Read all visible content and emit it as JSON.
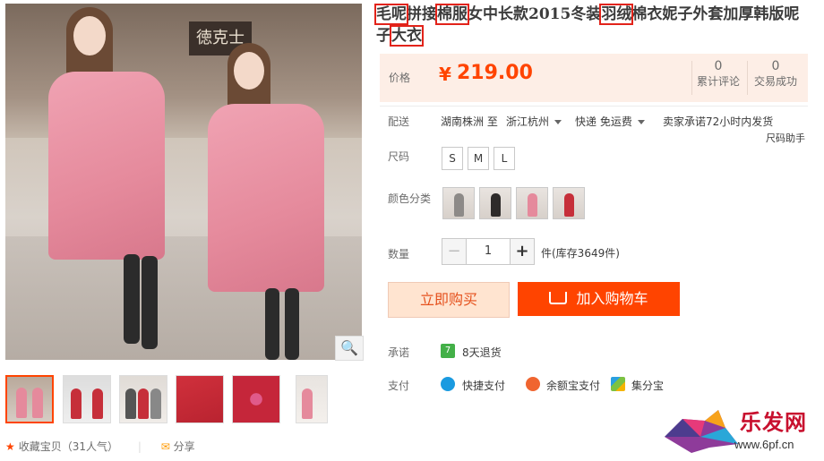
{
  "product": {
    "title_parts": [
      {
        "text": "毛呢",
        "highlight": true
      },
      {
        "text": "拼接",
        "highlight": false
      },
      {
        "text": "棉服",
        "highlight": true
      },
      {
        "text": "女中长款2015冬装",
        "highlight": false
      },
      {
        "text": "羽绒",
        "highlight": true
      },
      {
        "text": "棉衣妮子外套加厚韩版呢子",
        "highlight": false
      },
      {
        "text": "大衣",
        "highlight": true
      }
    ]
  },
  "price": {
    "label": "价格",
    "symbol": "¥",
    "value": "219.00"
  },
  "stats": [
    {
      "count": "0",
      "label": "累计评论"
    },
    {
      "count": "0",
      "label": "交易成功"
    }
  ],
  "shipping": {
    "label": "配送",
    "from": "湖南株洲 至",
    "to": "浙江杭州",
    "method": "快递 免运费",
    "promise": "卖家承诺72小时内发货",
    "size_help": "尺码助手"
  },
  "size": {
    "label": "尺码",
    "options": [
      "S",
      "M",
      "L"
    ]
  },
  "color": {
    "label": "颜色分类",
    "swatches": [
      "grey-coat",
      "black-coat",
      "pink-coat",
      "red-coat"
    ]
  },
  "quantity": {
    "label": "数量",
    "value": "1",
    "stock": "件(库存3649件)"
  },
  "buttons": {
    "buy": "立即购买",
    "cart": "加入购物车"
  },
  "promise": {
    "label": "承诺",
    "item": "8天退货"
  },
  "payment": {
    "label": "支付",
    "methods": [
      "快捷支付",
      "余额宝支付",
      "集分宝"
    ]
  },
  "bottom": {
    "favorite": "收藏宝贝（31人气）",
    "share": "分享"
  },
  "logo": {
    "text": "乐发网",
    "url": "www.6pf.cn"
  },
  "colors": {
    "accent": "#ff4400",
    "price_bg": "#fdeee6",
    "highlight_box": "#e2231a"
  }
}
